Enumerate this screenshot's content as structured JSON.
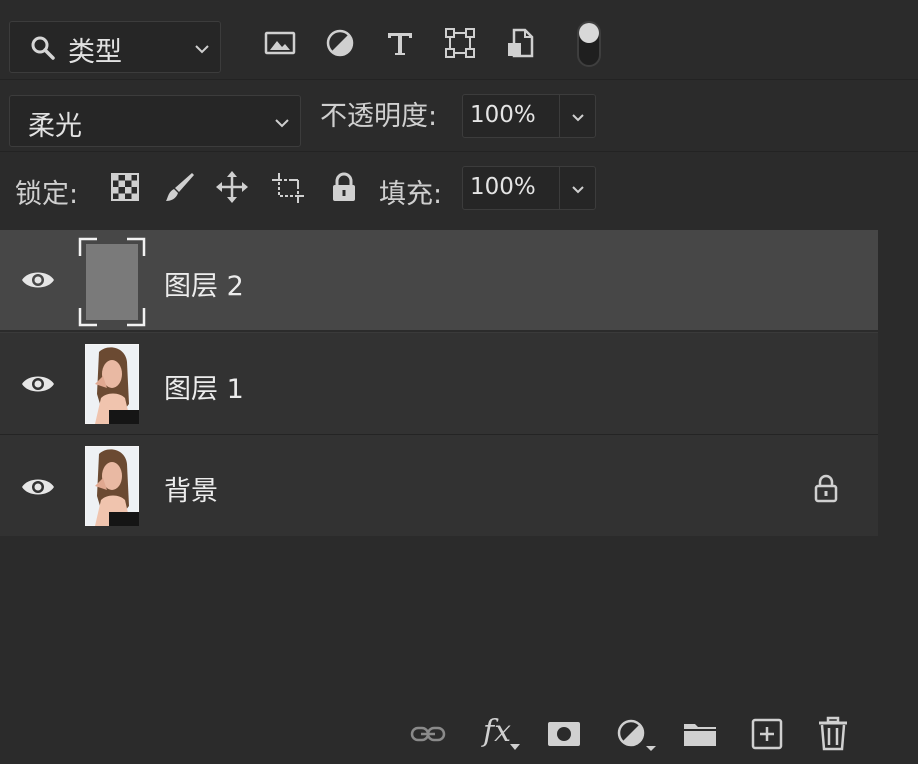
{
  "filter": {
    "label": "类型",
    "icons": [
      "image-filter-icon",
      "adjustment-filter-icon",
      "type-filter-icon",
      "shape-filter-icon",
      "smart-object-filter-icon",
      "filter-toggle-icon"
    ]
  },
  "blend": {
    "mode": "柔光",
    "opacity_label": "不透明度:",
    "opacity_value": "100%"
  },
  "lock": {
    "label": "锁定:",
    "icons": [
      "lock-transparent-pixels-icon",
      "lock-image-pixels-icon",
      "lock-position-icon",
      "lock-artboard-icon",
      "lock-all-icon"
    ],
    "fill_label": "填充:",
    "fill_value": "100%"
  },
  "layers": [
    {
      "name": "图层 2",
      "selected": true,
      "locked": false,
      "thumb": "gray-fill"
    },
    {
      "name": "图层 1",
      "selected": false,
      "locked": false,
      "thumb": "portrait"
    },
    {
      "name": "背景",
      "selected": false,
      "locked": true,
      "thumb": "portrait"
    }
  ],
  "footer": {
    "icons": [
      "link-layers-icon",
      "fx-icon",
      "add-mask-icon",
      "new-adjustment-icon",
      "new-group-icon",
      "new-layer-icon",
      "delete-layer-icon"
    ],
    "fx_text": "fx"
  },
  "colors": {
    "panel_bg": "#2b2b2b",
    "selected_row": "#474747",
    "row_bg": "#323232",
    "icon": "#d0d0d0"
  }
}
